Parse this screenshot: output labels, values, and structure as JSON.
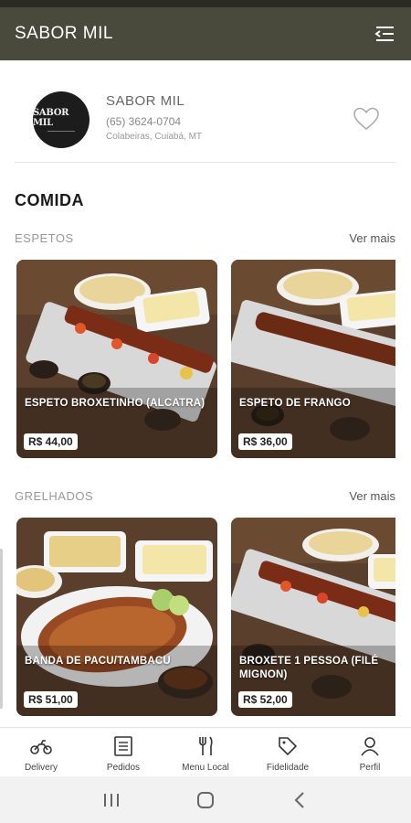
{
  "app": {
    "title": "SABOR MIL"
  },
  "store": {
    "logo_text": "SABOR MIL",
    "name": "SABOR MIL",
    "phone": "(65) 3624-0704",
    "location": "Colabeiras, Cuiabá, MT"
  },
  "section": {
    "title": "COMIDA"
  },
  "categories": [
    {
      "title": "ESPETOS",
      "see_more": "Ver mais",
      "items": [
        {
          "name": "ESPETO BROXETINHO (ALCATRA)",
          "price": "R$ 44,00"
        },
        {
          "name": "ESPETO DE  FRANGO",
          "price": "R$ 36,00"
        }
      ]
    },
    {
      "title": "GRELHADOS",
      "see_more": "Ver mais",
      "items": [
        {
          "name": "BANDA DE PACU/TAMBACU",
          "price": "R$ 51,00"
        },
        {
          "name": "BROXETE 1 PESSOA (FILÉ MIGNON)",
          "price": "R$ 52,00"
        }
      ]
    }
  ],
  "bottom_nav": [
    {
      "label": "Delivery",
      "icon": "motorcycle-icon"
    },
    {
      "label": "Pedidos",
      "icon": "receipt-icon"
    },
    {
      "label": "Menu Local",
      "icon": "cutlery-icon"
    },
    {
      "label": "Fidelidade",
      "icon": "tag-icon"
    },
    {
      "label": "Perfil",
      "icon": "person-icon"
    }
  ],
  "colors": {
    "appbar": "#4a4a3c",
    "statusbar": "#2b2b24",
    "card_text": "#ffffff"
  }
}
